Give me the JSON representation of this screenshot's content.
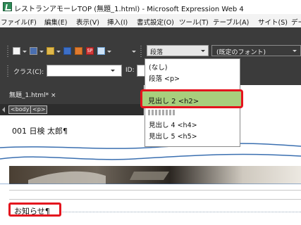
{
  "window": {
    "title": "レストランアモーレTOP (無題_1.html) - Microsoft Expression Web 4"
  },
  "menubar": {
    "items": [
      "ファイル(F)",
      "編集(E)",
      "表示(V)",
      "挿入(I)",
      "書式設定(O)",
      "ツール(T)",
      "テーブル(A)",
      "サイト(S)",
      "デー"
    ]
  },
  "toolbar": {
    "style_select_value": "段落",
    "font_select_value": "(既定のフォント)",
    "class_label": "クラス(C):",
    "id_label": "ID:"
  },
  "document": {
    "tab_label": "無題_1.html* ×",
    "tag_body": "<body>",
    "tag_p": "<p>",
    "name_line": "001 日検 太郎¶",
    "notice": "お知らせ¶"
  },
  "style_dropdown": {
    "items": [
      "(なし)",
      "段落 <p>",
      "見出し 2 <h2>",
      "見出し 4 <h4>",
      "見出し 5 <h5>"
    ],
    "selected": "見出し 2 <h2>"
  },
  "colors": {
    "highlight": "#a8cf7d",
    "callout_border": "#e4141e",
    "toolbar_bg": "#3b3b3b"
  }
}
